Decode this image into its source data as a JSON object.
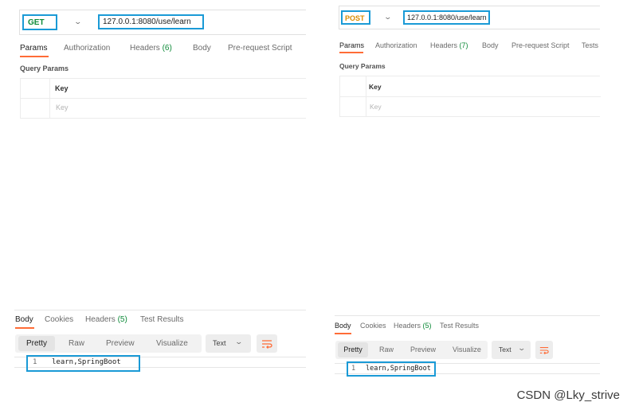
{
  "left": {
    "method": "GET",
    "method_color": "#0d8a38",
    "url": "127.0.0.1:8080/use/learn",
    "request_tabs": [
      {
        "label": "Params"
      },
      {
        "label": "Authorization"
      },
      {
        "label": "Headers",
        "count": "(6)"
      },
      {
        "label": "Body"
      },
      {
        "label": "Pre-request Script"
      }
    ],
    "section_title": "Query Params",
    "key_header": "Key",
    "key_placeholder": "Key",
    "response_tabs": [
      {
        "label": "Body"
      },
      {
        "label": "Cookies"
      },
      {
        "label": "Headers",
        "count": "(5)"
      },
      {
        "label": "Test Results"
      }
    ],
    "format_buttons": [
      "Pretty",
      "Raw",
      "Preview",
      "Visualize"
    ],
    "format_select": "Text",
    "code_line_number": "1",
    "code_line_text": "learn,SpringBoot"
  },
  "right": {
    "method": "POST",
    "method_color": "#d98b00",
    "url": "127.0.0.1:8080/use/learn",
    "request_tabs": [
      {
        "label": "Params"
      },
      {
        "label": "Authorization"
      },
      {
        "label": "Headers",
        "count": "(7)"
      },
      {
        "label": "Body"
      },
      {
        "label": "Pre-request Script"
      },
      {
        "label": "Tests"
      }
    ],
    "section_title": "Query Params",
    "key_header": "Key",
    "key_placeholder": "Key",
    "response_tabs": [
      {
        "label": "Body"
      },
      {
        "label": "Cookies"
      },
      {
        "label": "Headers",
        "count": "(5)"
      },
      {
        "label": "Test Results"
      }
    ],
    "format_buttons": [
      "Pretty",
      "Raw",
      "Preview",
      "Visualize"
    ],
    "format_select": "Text",
    "code_line_number": "1",
    "code_line_text": "learn,SpringBoot"
  },
  "colors": {
    "accent": "#ff6c37",
    "highlight": "#1a9ad6",
    "count_green": "#0d8a38"
  },
  "watermark": "CSDN @Lky_strive"
}
